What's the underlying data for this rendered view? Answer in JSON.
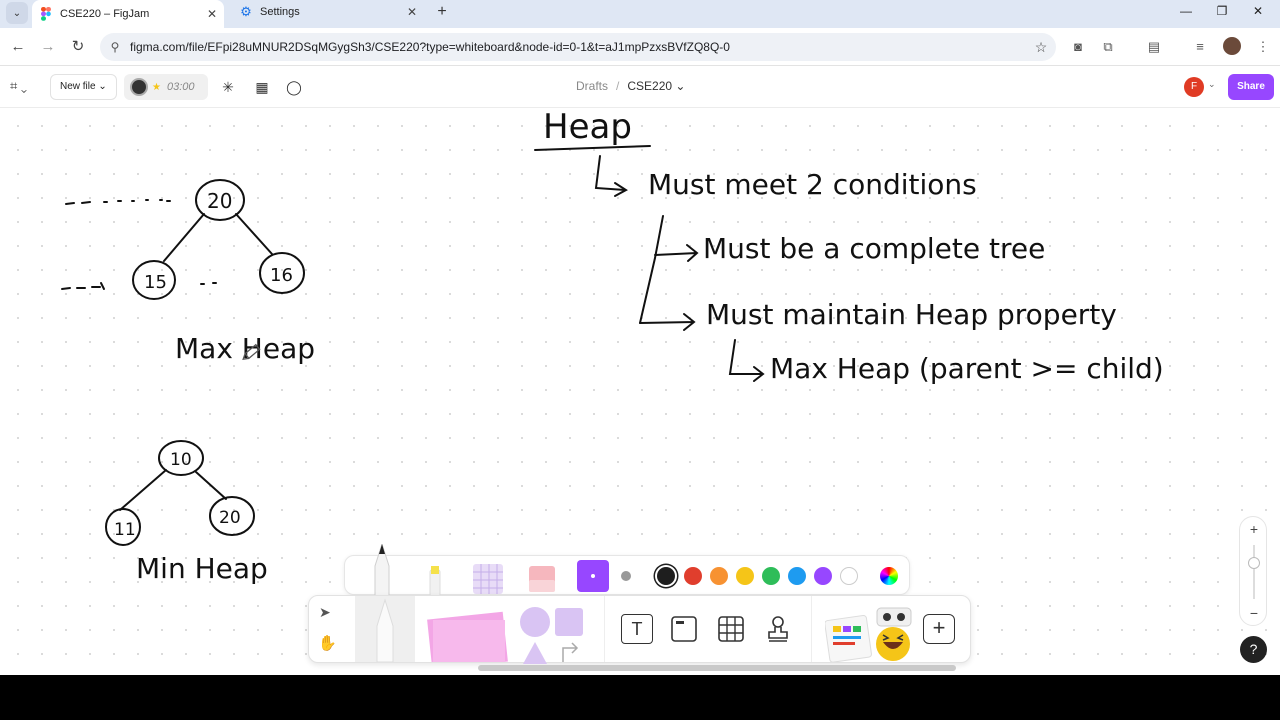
{
  "browser": {
    "tabs": [
      {
        "title": "CSE220 – FigJam",
        "active": true
      },
      {
        "title": "Settings",
        "active": false
      }
    ],
    "url": "figma.com/file/EFpi28uMNUR2DSqMGygSh3/CSE220?type=whiteboard&node-id=0-1&t=aJ1mpPzxsBVfZQ8Q-0"
  },
  "figjam": {
    "new_file_label": "New file ⌄",
    "timer": "03:00",
    "breadcrumb_parent": "Drafts",
    "breadcrumb_sep": "/",
    "file_name": "CSE220 ⌄",
    "user_initial": "F",
    "share_label": "Share"
  },
  "board": {
    "title": "Heap",
    "line1": "Must meet 2 conditions",
    "line2": "Must be a complete tree",
    "line3": "Must maintain Heap property",
    "line4": "Max Heap (parent >= child)",
    "max_heap_label": "Max Heap",
    "min_heap_label": "Min Heap",
    "max_tree": {
      "root": "20",
      "left": "15",
      "right": "16"
    },
    "min_tree": {
      "root": "10",
      "left": "11",
      "right": "20"
    }
  },
  "colors": {
    "accent": "#9747ff",
    "palette": [
      "#1e1e1e",
      "#e03e2d",
      "#f79232",
      "#f5c518",
      "#2ebd59",
      "#1e9bf0",
      "#9747ff",
      "#ffffff"
    ]
  },
  "zoom": {
    "plus": "+",
    "minus": "−"
  },
  "help_label": "?"
}
